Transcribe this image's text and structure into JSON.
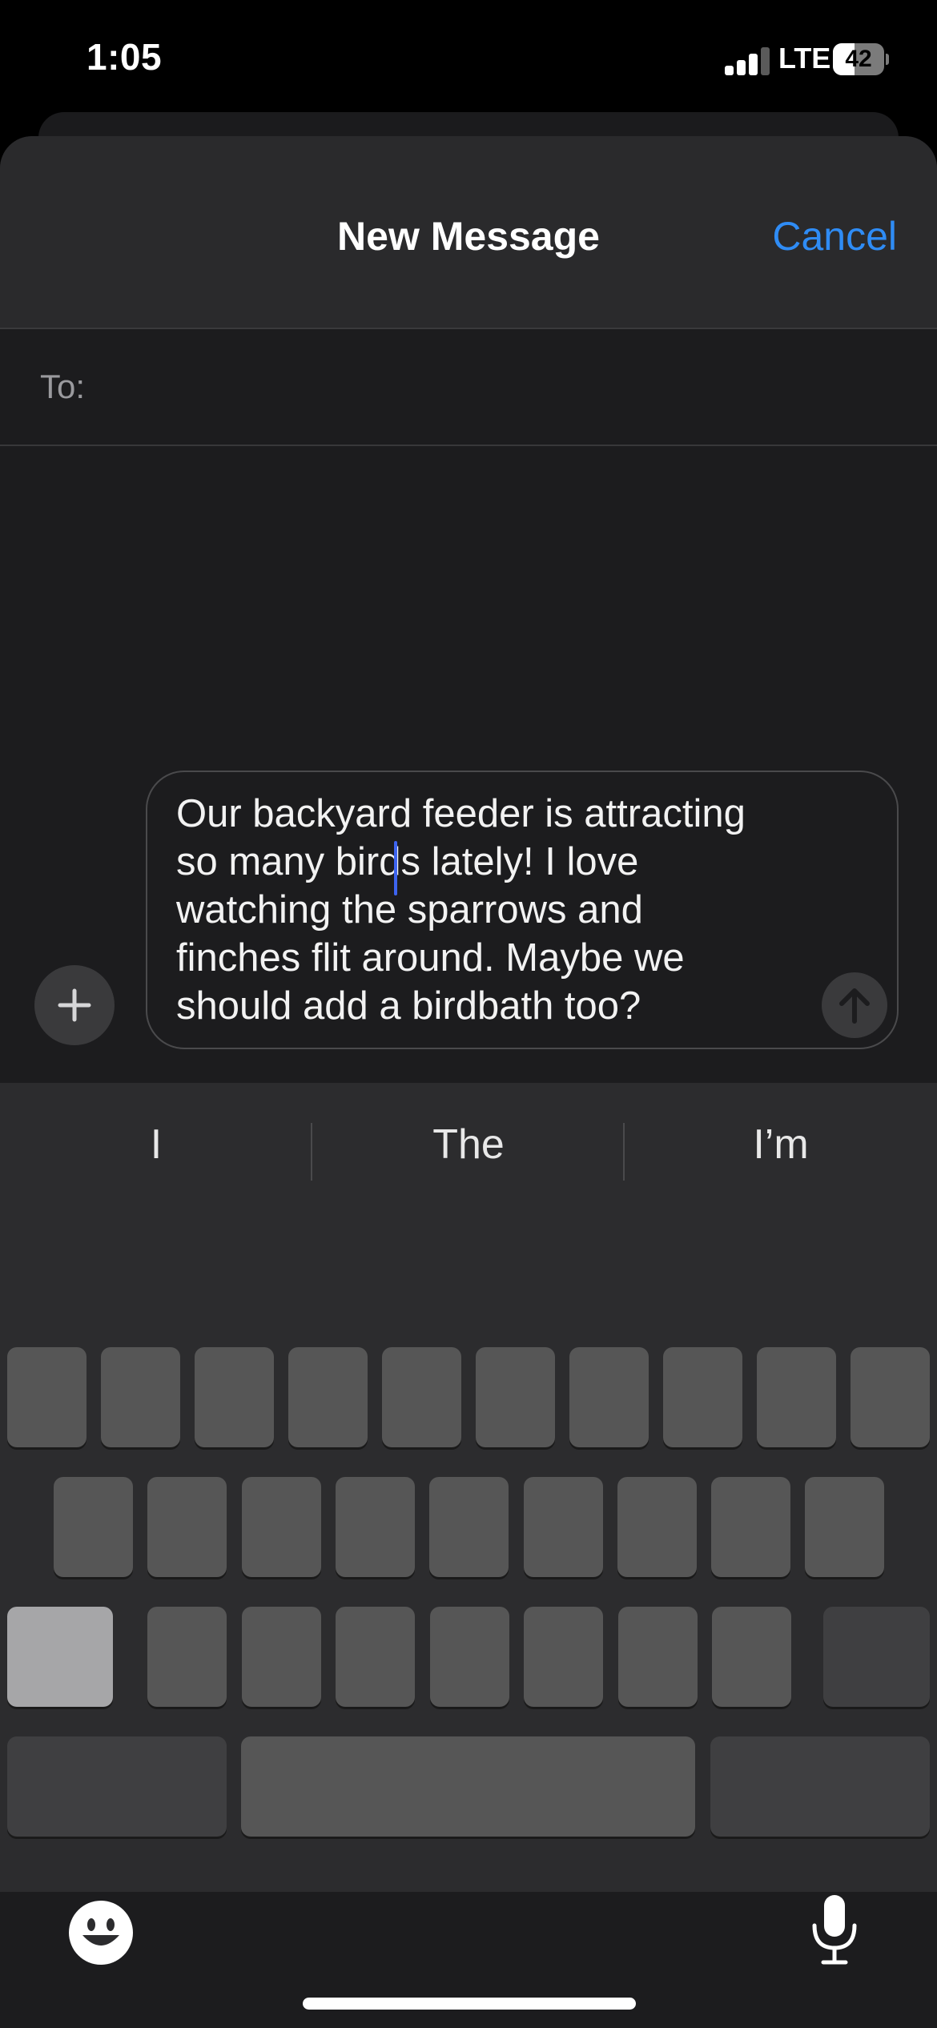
{
  "status_bar": {
    "time": "1:05",
    "network": "LTE",
    "battery": "42",
    "battery_fraction": 0.42,
    "signal_bars_active": 3,
    "signal_bars_total": 4
  },
  "sheet": {
    "title": "New Message",
    "cancel_label": "Cancel",
    "to_label": "To:"
  },
  "compose": {
    "lines": [
      "Our backyard feeder is attracting",
      "so many birds lately! I love",
      "watching the sparrows and",
      "finches flit around. Maybe we",
      "should add a birdbath too?"
    ]
  },
  "keyboard": {
    "suggestions": [
      "I",
      "The",
      "I’m"
    ]
  },
  "colors": {
    "accent": "#2f8cf5",
    "caret": "#3d64f0",
    "sheet_background": "#1c1c1e",
    "nav_background": "#2a2a2c",
    "keyboard_background": "#2c2c2e",
    "key_background": "#565656"
  },
  "icons": {
    "add": "plus-icon",
    "send": "arrow-up-icon",
    "emoji": "smiley-icon",
    "dictation": "microphone-icon"
  }
}
